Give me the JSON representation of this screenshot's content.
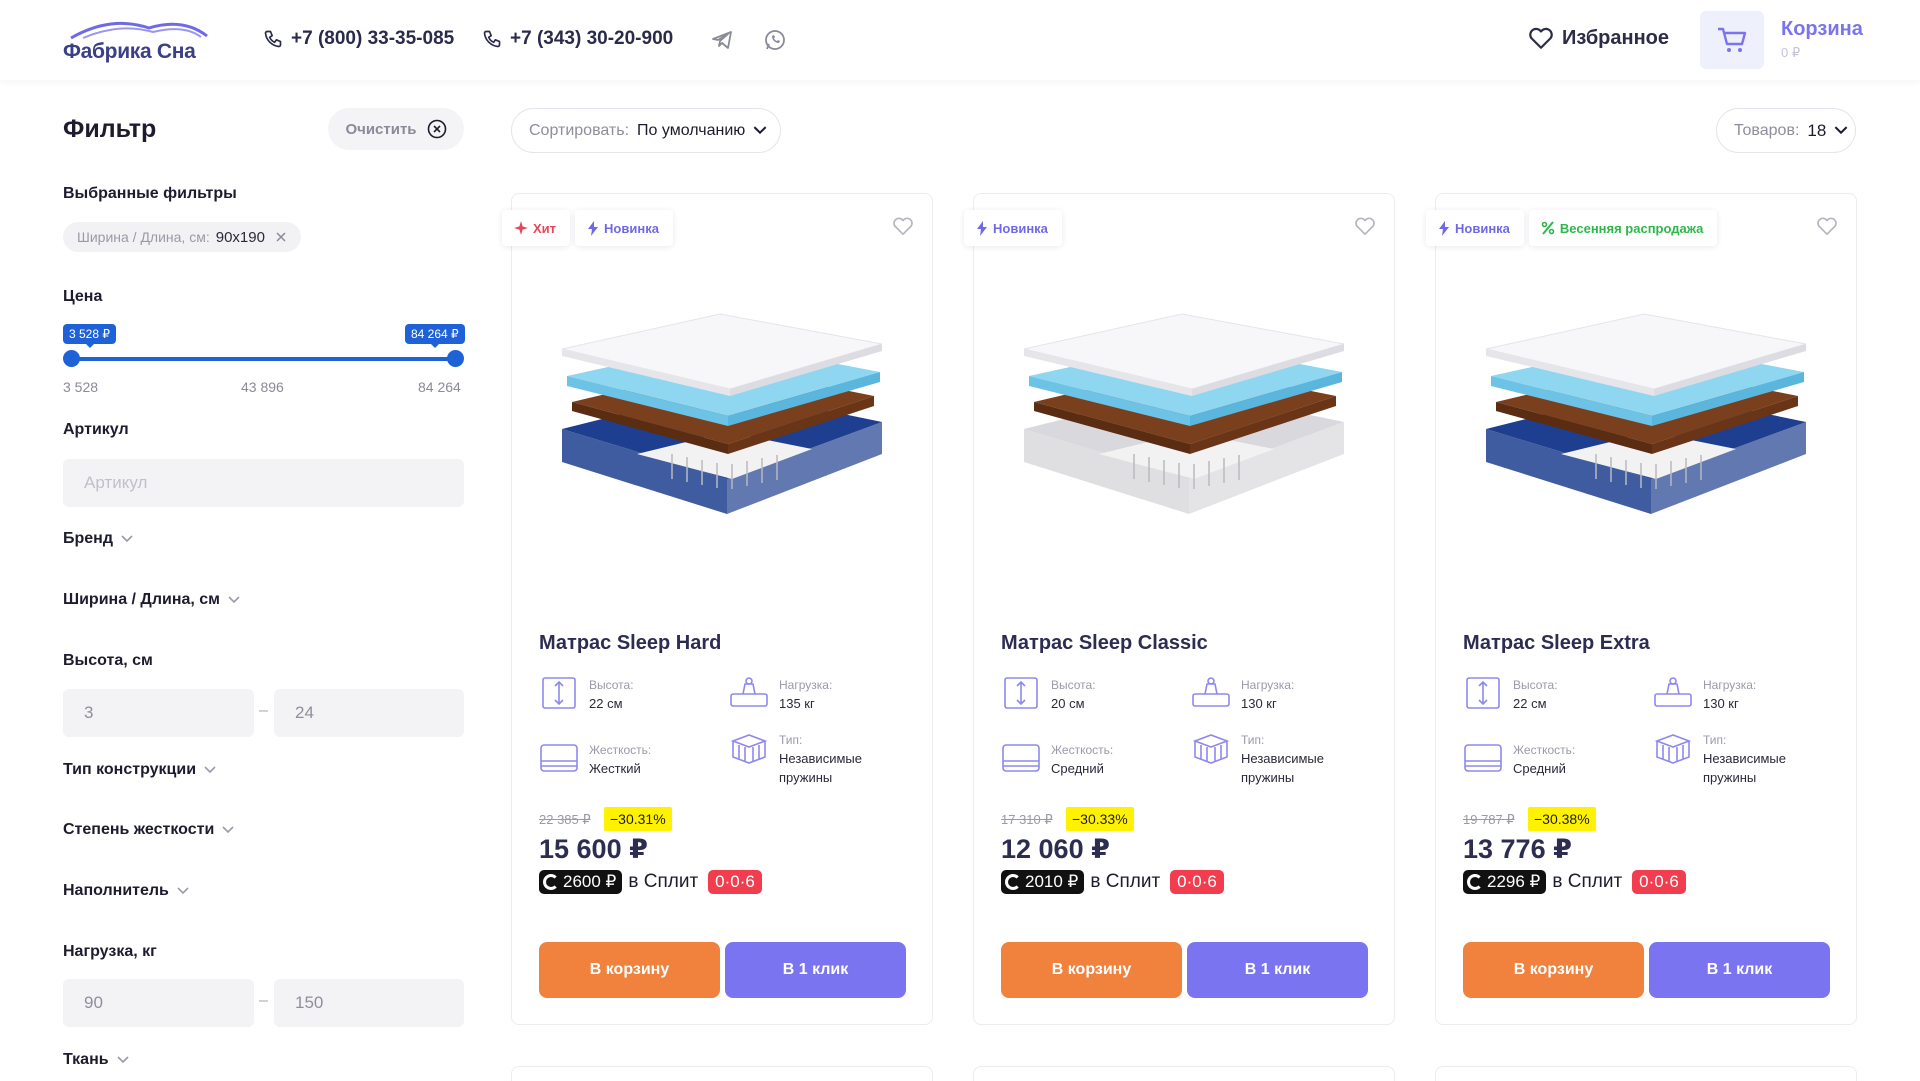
{
  "header": {
    "logo_text": "Фабрика Сна",
    "phone1": "+7 (800) 33-35-085",
    "phone2": "+7 (343) 30-20-900",
    "favorites_label": "Избранное",
    "cart_label": "Корзина",
    "cart_sum": "0 ₽"
  },
  "filter": {
    "title": "Фильтр",
    "clear_label": "Очистить",
    "selected_label": "Выбранные фильтры",
    "chip_key": "Ширина / Длина, см:",
    "chip_value": "90х190",
    "price_label": "Цена",
    "price_min_tip": "3 528 ₽",
    "price_max_tip": "84 264 ₽",
    "price_scale_min": "3 528",
    "price_scale_mid": "43 896",
    "price_scale_max": "84 264",
    "article_label": "Артикул",
    "article_placeholder": "Артикул",
    "brand_label": "Бренд",
    "size_label": "Ширина / Длина, см",
    "height_label": "Высота, см",
    "height_from": "3",
    "height_to": "24",
    "construction_label": "Тип конструкции",
    "firmness_label": "Степень жесткости",
    "filler_label": "Наполнитель",
    "load_label": "Нагрузка, кг",
    "load_from": "90",
    "load_to": "150",
    "fabric_label": "Ткань"
  },
  "toolbar": {
    "sort_label": "Сортировать:",
    "sort_value": "По умолчанию",
    "count_label": "Товаров:",
    "count_value": "18"
  },
  "spec_labels": {
    "height": "Высота:",
    "load": "Нагрузка:",
    "firmness": "Жесткость:",
    "type": "Тип:"
  },
  "buttons": {
    "cart": "В корзину",
    "one_click": "В 1 клик",
    "split_in": "в Сплит",
    "split_code": "0·0·6"
  },
  "products": [
    {
      "name": "Матрас Sleep Hard",
      "badges": [
        "Хит",
        "Новинка"
      ],
      "height": "22 см",
      "load": "135 кг",
      "firmness": "Жесткий",
      "type": "Независимые пружины",
      "old_price": "22 385 ₽",
      "discount": "−30.31%",
      "price": "15 600 ₽",
      "split": "2600 ₽",
      "base_color": "#1e3f8f"
    },
    {
      "name": "Матрас Sleep Classic",
      "badges": [
        "Новинка"
      ],
      "height": "20 см",
      "load": "130 кг",
      "firmness": "Средний",
      "type": "Независимые пружины",
      "old_price": "17 310 ₽",
      "discount": "−30.33%",
      "price": "12 060 ₽",
      "split": "2010 ₽",
      "base_color": "#d9d9dd"
    },
    {
      "name": "Матрас Sleep Extra",
      "badges": [
        "Новинка",
        "Весенняя распродажа"
      ],
      "height": "22 см",
      "load": "130 кг",
      "firmness": "Средний",
      "type": "Независимые пружины",
      "old_price": "19 787 ₽",
      "discount": "−30.38%",
      "price": "13 776 ₽",
      "split": "2296 ₽",
      "base_color": "#1e3f8f"
    }
  ],
  "colors": {
    "accent_orange": "#f0823e",
    "accent_violet": "#7b74f0",
    "range_blue": "#1f62d8",
    "discount_yellow": "#fff200",
    "split_red": "#f23d4f"
  },
  "icons": [
    "phone-icon",
    "telegram-icon",
    "whatsapp-icon",
    "heart-icon",
    "cart-icon",
    "close-circle-icon",
    "chevron-down-icon",
    "star-icon",
    "lightning-icon",
    "percent-icon"
  ]
}
